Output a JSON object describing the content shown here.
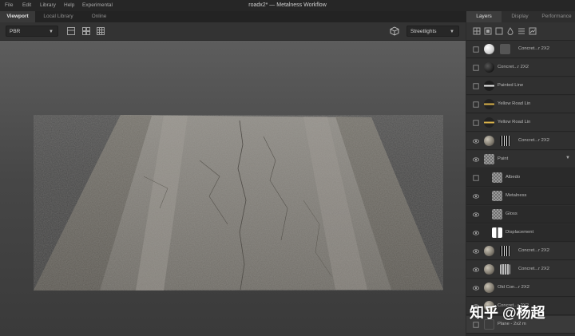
{
  "menu": [
    "File",
    "Edit",
    "Library",
    "Help",
    "Experimental"
  ],
  "window_title": "roadx2* — Metalness Workflow",
  "view_tabs": [
    "Viewport",
    "Local Library",
    "Online"
  ],
  "toolbar": {
    "render_mode": "PBR",
    "environment": "Streetlights"
  },
  "panel_tabs": [
    "Layers",
    "Display",
    "Performance"
  ],
  "layers": [
    {
      "name": "Concret...r 2X2",
      "visible": false,
      "thumb": "white-sphere",
      "mask": "gray"
    },
    {
      "name": "Concret...r 2X2",
      "visible": false,
      "thumb": "dark-sphere"
    },
    {
      "name": "Painted Line",
      "visible": false,
      "thumb": "white-line-sphere"
    },
    {
      "name": "Yellow Road Lin",
      "visible": false,
      "thumb": "yellow-line-sphere"
    },
    {
      "name": "Yellow Road Lin",
      "visible": false,
      "thumb": "yellow-line-sphere"
    },
    {
      "name": "Concret...r 2X2",
      "visible": true,
      "thumb": "concrete-sphere",
      "mask": "stripes"
    },
    {
      "name": "Paint",
      "visible": true,
      "thumb": "checker",
      "group": true
    },
    {
      "name": "Albedo",
      "visible": false,
      "thumb": "checker",
      "sub": true
    },
    {
      "name": "Metalness",
      "visible": true,
      "thumb": "checker",
      "sub": true
    },
    {
      "name": "Gloss",
      "visible": true,
      "thumb": "checker",
      "sub": true
    },
    {
      "name": "Displacement",
      "visible": true,
      "thumb": "white-bar",
      "sub": true
    },
    {
      "name": "Concret...r 2X2",
      "visible": true,
      "thumb": "concrete-sphere",
      "mask": "stripes"
    },
    {
      "name": "Concret...r 2X2",
      "visible": true,
      "thumb": "concrete-sphere",
      "mask": "stripes-light"
    },
    {
      "name": "Old Con...r 2X2",
      "visible": true,
      "thumb": "concrete-sphere"
    },
    {
      "name": "Concret...r 2X2",
      "visible": true,
      "thumb": "concrete-sphere"
    },
    {
      "name": "Plane - 2x2 m",
      "visible": false,
      "thumb": "plane",
      "selected": true
    }
  ],
  "watermark": "知乎 @杨超"
}
